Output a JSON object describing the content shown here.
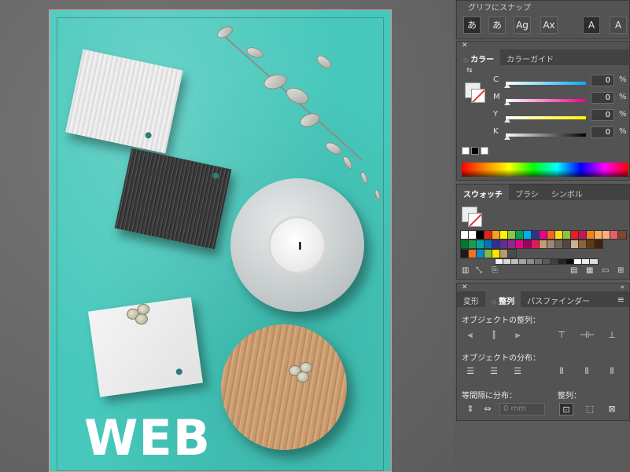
{
  "artwork": {
    "headline": "WEB"
  },
  "char_panel": {
    "title": "グリフにスナップ",
    "buttons": [
      "あ",
      "あ",
      "Ag",
      "Ax",
      "A",
      "A"
    ]
  },
  "color_panel": {
    "tabs": [
      {
        "label": "カラー",
        "active": true
      },
      {
        "label": "カラーガイド",
        "active": false
      }
    ],
    "sliders": [
      {
        "label": "C",
        "value": "0",
        "unit": "%",
        "gradient": "linear-gradient(to right,#ffffff,#00aeef)"
      },
      {
        "label": "M",
        "value": "0",
        "unit": "%",
        "gradient": "linear-gradient(to right,#ffffff,#ec008c)"
      },
      {
        "label": "Y",
        "value": "0",
        "unit": "%",
        "gradient": "linear-gradient(to right,#ffffff,#fff200)"
      },
      {
        "label": "K",
        "value": "0",
        "unit": "%",
        "gradient": "linear-gradient(to right,#ffffff,#000000)"
      }
    ],
    "fill_color": "#ededed"
  },
  "swatches_panel": {
    "tabs": [
      {
        "label": "スウォッチ",
        "active": true
      },
      {
        "label": "ブラシ",
        "active": false
      },
      {
        "label": "シンボル",
        "active": false
      }
    ],
    "row1": [
      "#ffffff",
      "#ffffff",
      "#000000",
      "#e2231a",
      "#f7a21b",
      "#fff200",
      "#8dc63f",
      "#00a651",
      "#00aeef",
      "#2e3192",
      "#ec008c",
      "#f26522",
      "#ffde17",
      "#8dc63f",
      "#ed1c24",
      "#c2185b",
      "#f58220",
      "#fbaf5d",
      "#f9ad81",
      "#e85e6c",
      "#7d4a2a"
    ],
    "row2": [
      "#007a33",
      "#1a9b50",
      "#00a99d",
      "#0072bc",
      "#2e3192",
      "#662d91",
      "#92278f",
      "#ec008c",
      "#9e005d",
      "#ed145b",
      "#c69c6d",
      "#998675",
      "#736357",
      "#534741",
      "#c7b299",
      "#8c6239",
      "#603913",
      "#42210b"
    ],
    "row3_dark": [
      "#1a1a1a",
      "#f36f21",
      "#0b8acb",
      "#7ac143",
      "#ffe600",
      "#b59c6a",
      "#4b4b4b"
    ],
    "grays": [
      "#f2f2f2",
      "#d9d9d9",
      "#bfbfbf",
      "#a6a6a6",
      "#8c8c8c",
      "#737373",
      "#595959",
      "#404040",
      "#262626",
      "#0d0d0d",
      "#ffffff",
      "#eeeeee",
      "#dddddd"
    ]
  },
  "align_panel": {
    "tabs": [
      {
        "label": "変形",
        "active": false
      },
      {
        "label": "整列",
        "active": true
      },
      {
        "label": "パスファインダー",
        "active": false
      }
    ],
    "sections": {
      "align_objects": "オブジェクトの整列：",
      "distribute_objects": "オブジェクトの分布：",
      "distribute_spacing": "等間隔に分布：",
      "align_to": "整列："
    },
    "spacing_value": "0 mm"
  }
}
